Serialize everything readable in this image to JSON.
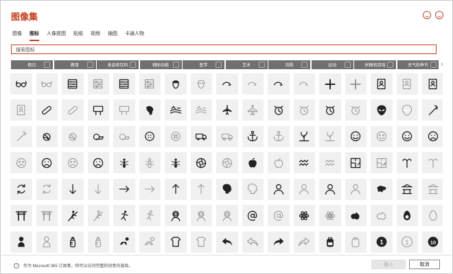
{
  "dialog": {
    "title": "图像集"
  },
  "tabs": [
    "图像",
    "图标",
    "人像抠图",
    "贴纸",
    "视频",
    "插图",
    "卡通人物"
  ],
  "active_tab": "图标",
  "search": {
    "placeholder": "搜索图标"
  },
  "categories": [
    "假日",
    "教育",
    "食品和饮料",
    "辅助功能",
    "医学",
    "艺术",
    "流程",
    "运动",
    "拼图和游戏",
    "天气和季节"
  ],
  "icons": [
    [
      "glasses-3d",
      "glasses-3d-outline",
      "abacus",
      "abacus-outline",
      "abacus-filled",
      "abacus-grid-outline",
      "acorn",
      "acorn-outline",
      "arrow-curve-right",
      "arrow-curve-right-outline",
      "arrow-curve-left",
      "arrow-curve-left-outline",
      "plus",
      "plus-outline",
      "address-book",
      "address-book-outline",
      "address-book-filled"
    ],
    [
      "address-book-light",
      "bandage",
      "bandage-outline",
      "billboard",
      "billboard-outline",
      "africa",
      "farm",
      "farm-outline",
      "airplane",
      "airplane-outline",
      "alarm-clock",
      "alarm-clock-outline",
      "alarm-ringing",
      "alarm-ringing-outline",
      "alien",
      "alien-outline",
      "needle-thread"
    ],
    [
      "needle-thread-outline",
      "yarn",
      "yarn-outline",
      "tape-measure",
      "tape-measure-outline",
      "button",
      "button-outline",
      "ambulance",
      "ambulance-outline",
      "anchor",
      "anchor-outline",
      "coral",
      "coral-outline",
      "angel-face",
      "smile-outline",
      "happy-face",
      "angry-face"
    ],
    [
      "angry-face-outline",
      "sad-face",
      "sad-face-outline",
      "frown-face",
      "ant",
      "ant-outline",
      "antarctica",
      "aperture",
      "aperture-outline",
      "apple",
      "apple-outline",
      "aquarius",
      "aquarius-outline",
      "architecture-plan",
      "architecture-plan-outline",
      "aries",
      "aries-outline"
    ],
    [
      "refresh-arrows",
      "refresh-arrows-outline",
      "arrow-down",
      "arrow-down-outline",
      "arrow-right",
      "arrow-right-outline",
      "arrow-up",
      "arrow-up-outline",
      "head-profile",
      "head-profile-outline",
      "artist",
      "artist-outline",
      "astronomer",
      "astronomer-outline",
      "asia",
      "pagoda",
      "pagoda-outline"
    ],
    [
      "torii",
      "torii-outline",
      "climber",
      "climber-outline",
      "athlete",
      "athlete-outline",
      "astronaut",
      "astronaut-outline",
      "astronaut-light",
      "at-sign",
      "at-sign-outline",
      "atom",
      "atom-outline",
      "australia",
      "australia-outline",
      "avocado",
      "avocado-outline"
    ],
    [
      "baby",
      "baby-outline",
      "baby-bottle",
      "baby-bottle-outline",
      "crawling-baby",
      "crawling-baby-outline",
      "baby-onesie",
      "baby-onesie-outline",
      "reply-arrow",
      "reply-arrow-outline",
      "forward-arrow",
      "forward-arrow-outline",
      "backpack",
      "backpack-outline",
      "number-one",
      "number-one-outline",
      "number-ten"
    ]
  ],
  "footer": {
    "note": "作为 Microsoft 365 订阅者，你可以访问完整的创意内容库。",
    "insert_label": "插入",
    "cancel_label": "取消"
  }
}
